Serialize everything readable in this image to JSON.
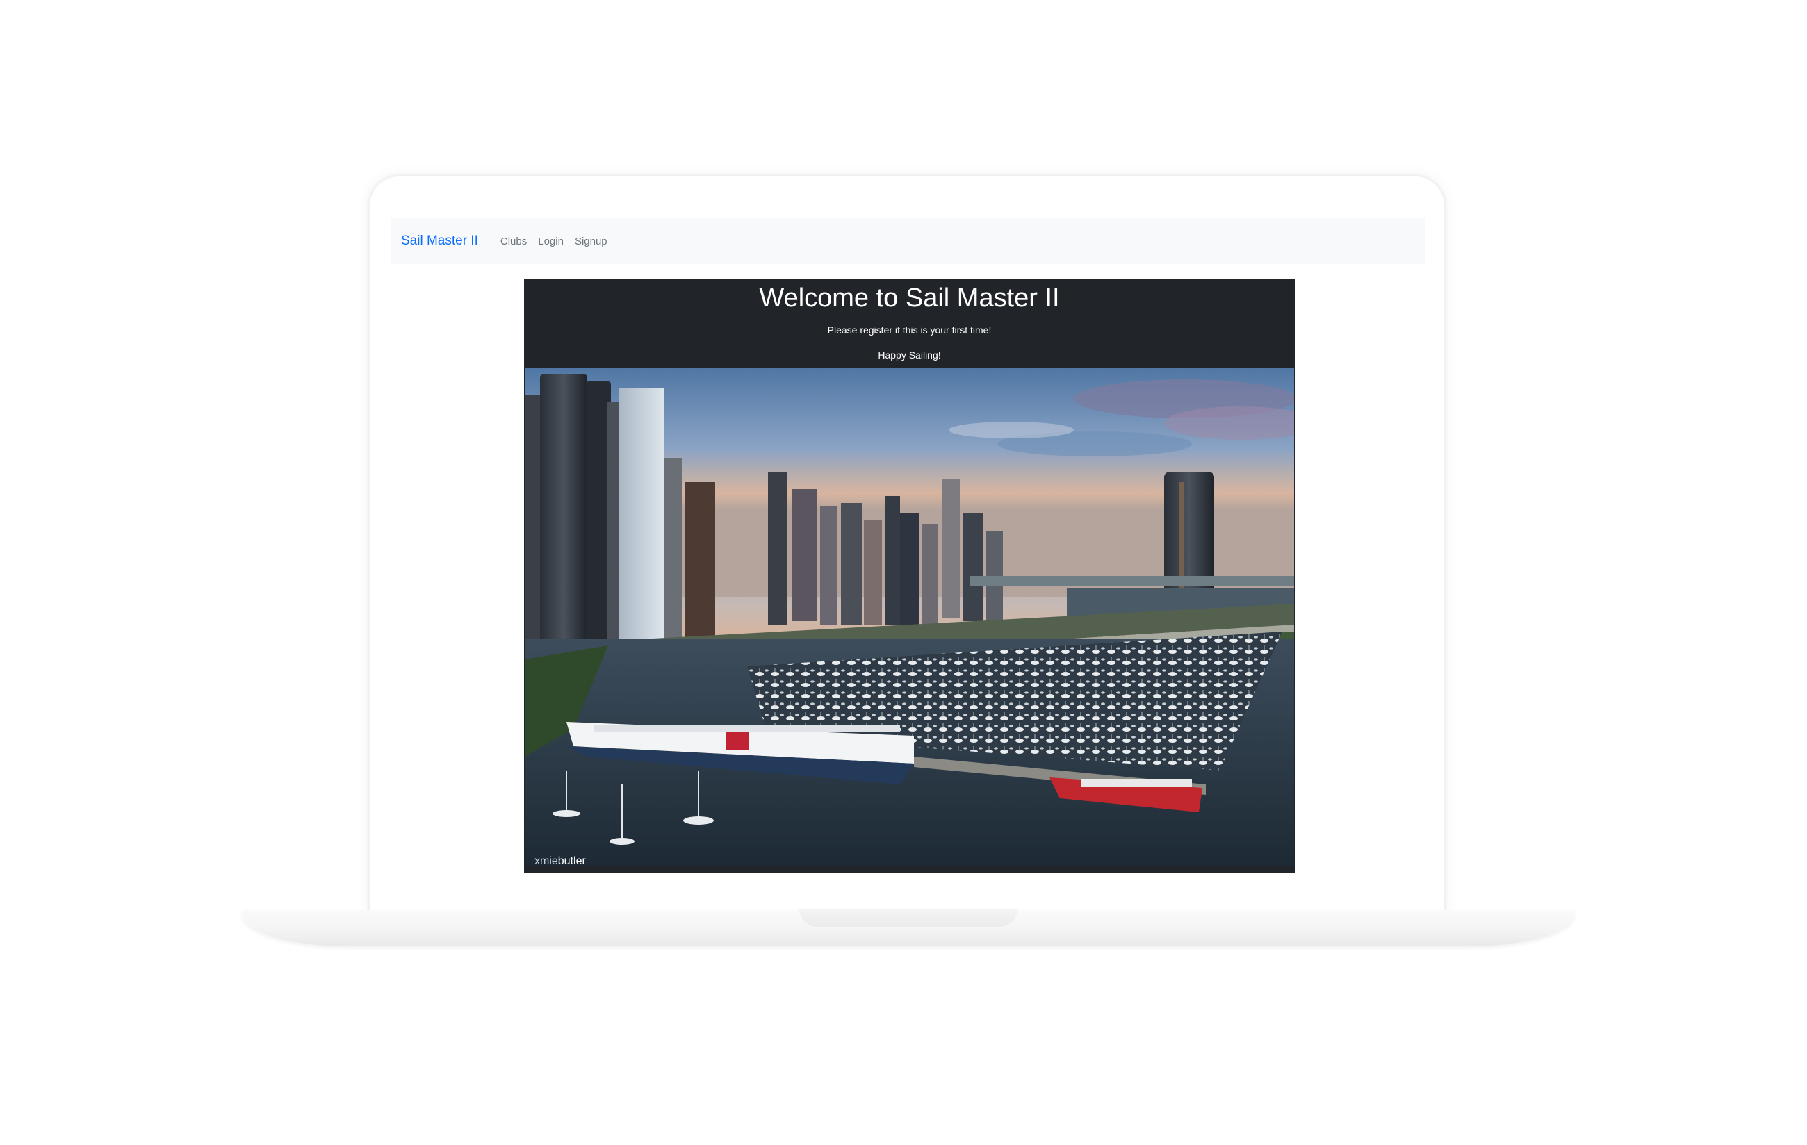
{
  "navbar": {
    "brand": "Sail Master II",
    "links": [
      {
        "label": "Clubs"
      },
      {
        "label": "Login"
      },
      {
        "label": "Signup"
      }
    ]
  },
  "hero": {
    "title": "Welcome to Sail Master II",
    "subtitle": "Please register if this is your first time!",
    "tagline": "Happy Sailing!",
    "photo": {
      "subject": "city-skyline-harbor-with-sailboats",
      "watermark_first": "xmie",
      "watermark_last": "butler"
    }
  },
  "colors": {
    "brand": "#0d6efd",
    "navbar_bg": "#f8f9fa",
    "hero_bg": "#212529",
    "nav_link": "#6c757d"
  }
}
